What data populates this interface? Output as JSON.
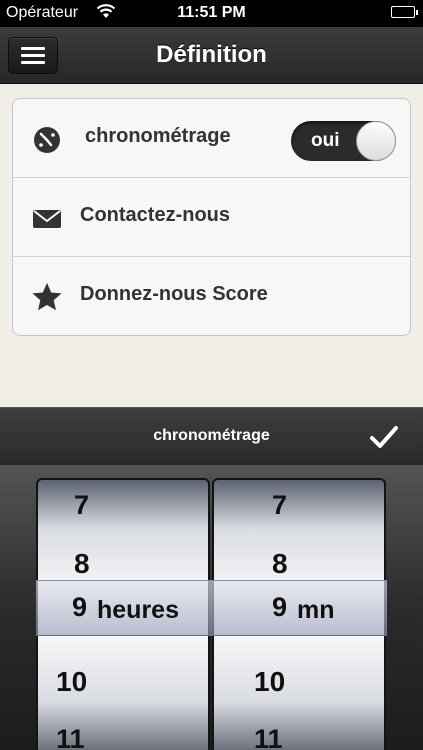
{
  "status_bar": {
    "carrier": "Opérateur",
    "time": "11:51 PM"
  },
  "nav": {
    "title": "Définition",
    "menu_icon": "hamburger-menu-icon"
  },
  "settings": {
    "items": [
      {
        "label": "chronométrage",
        "icon": "stopwatch-icon",
        "toggle": {
          "label": "oui",
          "on": true
        }
      },
      {
        "label": "Contactez-nous",
        "icon": "envelope-icon"
      },
      {
        "label": "Donnez-nous Score",
        "icon": "star-icon"
      }
    ]
  },
  "picker": {
    "title": "chronométrage",
    "done_icon": "checkmark-icon",
    "hours": {
      "values": [
        "7",
        "8",
        "9",
        "10",
        "11"
      ],
      "selected": "9",
      "unit": "heures"
    },
    "minutes": {
      "values": [
        "7",
        "8",
        "9",
        "10",
        "11"
      ],
      "selected": "9",
      "unit": "mn"
    }
  },
  "colors": {
    "background": "#f1eee8",
    "bar": "#2b2b2b",
    "text": "#333333"
  }
}
